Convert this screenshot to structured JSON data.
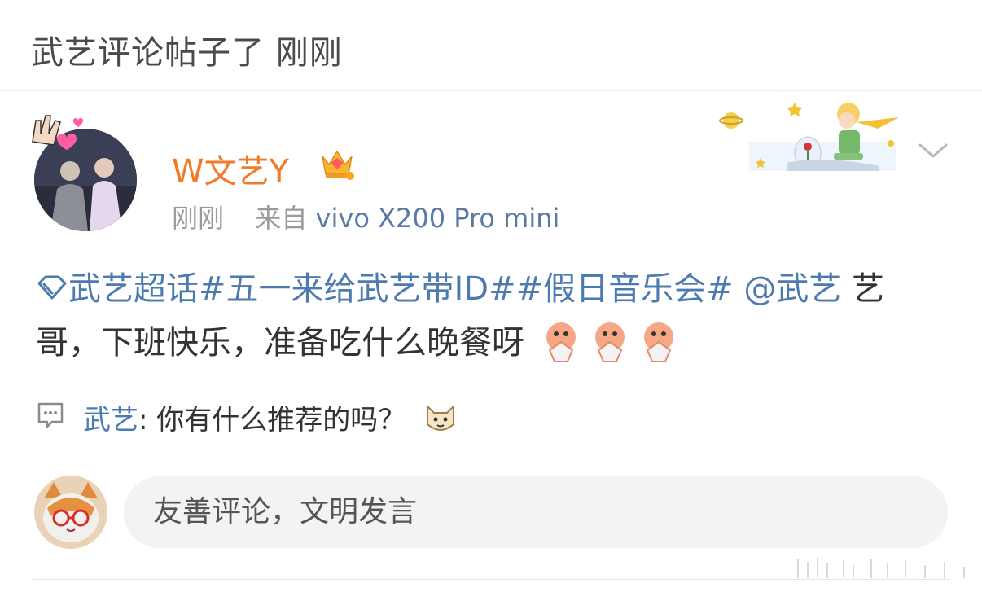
{
  "header": {
    "title": "武艺评论帖子了 刚刚"
  },
  "post": {
    "username": "W文艺Y",
    "time": "刚刚",
    "source_prefix": "来自",
    "source_device": "vivo X200 Pro mini",
    "topics": "武艺超话#五一来给武艺带ID##假日音乐会#",
    "mention": "@武艺",
    "text": "艺哥，下班快乐，准备吃什么晚餐呀"
  },
  "reply": {
    "user": "武艺",
    "separator": ":",
    "text": "你有什么推荐的吗？"
  },
  "comment_input": {
    "placeholder": "友善评论，文明发言"
  },
  "colors": {
    "username": "#f07a27",
    "link": "#4d7bb0",
    "meta": "#9a9a9a",
    "input_bg": "#f3f3f3"
  },
  "icons": [
    "avatar-sticker",
    "crown-badge",
    "little-prince-decoration",
    "chevron-down-icon",
    "topic-diamond-icon",
    "clapping-emoji",
    "comment-bubble-icon",
    "cat-emoji"
  ]
}
